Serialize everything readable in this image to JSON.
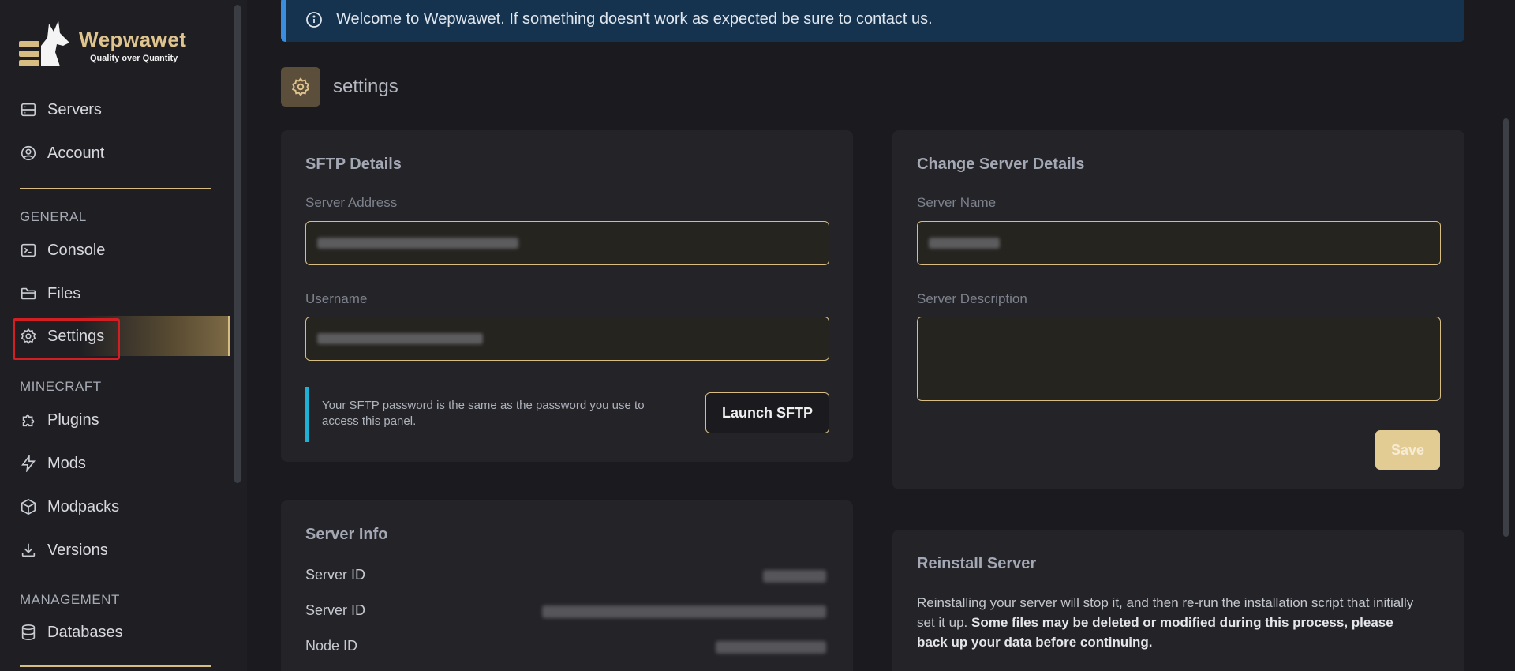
{
  "brand": {
    "name": "Wepwawet",
    "tagline": "Quality over Quantity"
  },
  "sidebar": {
    "top_items": [
      {
        "label": "Servers",
        "icon": "server-icon"
      },
      {
        "label": "Account",
        "icon": "user-circle-icon"
      }
    ],
    "sections": [
      {
        "title": "GENERAL",
        "items": [
          {
            "label": "Console",
            "icon": "terminal-icon"
          },
          {
            "label": "Files",
            "icon": "folder-icon"
          },
          {
            "label": "Settings",
            "icon": "gear-icon",
            "active": true
          }
        ]
      },
      {
        "title": "MINECRAFT",
        "items": [
          {
            "label": "Plugins",
            "icon": "puzzle-icon"
          },
          {
            "label": "Mods",
            "icon": "bolt-icon"
          },
          {
            "label": "Modpacks",
            "icon": "cube-icon"
          },
          {
            "label": "Versions",
            "icon": "download-icon"
          }
        ]
      },
      {
        "title": "MANAGEMENT",
        "items": [
          {
            "label": "Databases",
            "icon": "database-icon"
          }
        ]
      }
    ]
  },
  "banner": {
    "text": "Welcome to Wepwawet. If something doesn't work as expected be sure to contact us.",
    "icon": "info-icon"
  },
  "page": {
    "title": "settings",
    "icon": "gear-icon"
  },
  "sftp": {
    "title": "SFTP Details",
    "address_label": "Server Address",
    "username_label": "Username",
    "note": "Your SFTP password is the same as the password you use to access this panel.",
    "launch_label": "Launch SFTP"
  },
  "change_details": {
    "title": "Change Server Details",
    "name_label": "Server Name",
    "description_label": "Server Description",
    "save_label": "Save"
  },
  "server_info": {
    "title": "Server Info",
    "rows": [
      {
        "label": "Server ID"
      },
      {
        "label": "Server ID"
      },
      {
        "label": "Node ID"
      }
    ]
  },
  "reinstall": {
    "title": "Reinstall Server",
    "text": "Reinstalling your server will stop it, and then re-run the installation script that initially set it up.",
    "warning": "Some files may be deleted or modified during this process, please back up your data before continuing."
  },
  "colors": {
    "accent": "#d8bd83",
    "banner": "#15324e",
    "note_border": "#1fb0d6",
    "highlight": "#d11f24"
  }
}
